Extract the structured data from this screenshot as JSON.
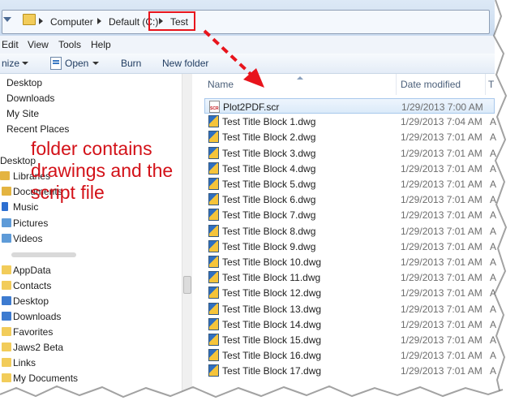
{
  "address": {
    "crumbs": [
      "Computer",
      "Default (C:)",
      "Test"
    ]
  },
  "menu": [
    "Edit",
    "View",
    "Tools",
    "Help"
  ],
  "toolbar": {
    "organize": "nize",
    "open": "Open",
    "burn": "Burn",
    "new_folder": "New folder"
  },
  "nav": {
    "items": [
      {
        "label": "Desktop",
        "icon": "desktop-icon",
        "color": "#3d7bd0"
      },
      {
        "label": "Downloads",
        "icon": "downloads-icon",
        "color": "#3d7bd0"
      },
      {
        "label": "My Site",
        "icon": "site-icon",
        "color": "#ffffff"
      },
      {
        "label": "Recent Places",
        "icon": "recent-places-icon",
        "color": "#ffffff"
      },
      {
        "label": "Desktop",
        "icon": "desktop-icon",
        "color": "#ffffff"
      },
      {
        "label": "Libraries",
        "icon": "libraries-icon",
        "color": "#e4b441"
      },
      {
        "label": "Documents",
        "icon": "documents-icon",
        "color": "#e4b441"
      },
      {
        "label": "Music",
        "icon": "music-icon",
        "color": "#2c6fd1"
      },
      {
        "label": "Pictures",
        "icon": "pictures-icon",
        "color": "#5e9bd8"
      },
      {
        "label": "Videos",
        "icon": "videos-icon",
        "color": "#5e9bd8"
      },
      {
        "label": "",
        "icon": "user-icon",
        "color": "#ffffff"
      },
      {
        "label": "AppData",
        "icon": "folder-icon",
        "color": "#f2cc5a"
      },
      {
        "label": "Contacts",
        "icon": "contacts-icon",
        "color": "#f2cc5a"
      },
      {
        "label": "Desktop",
        "icon": "folder-icon",
        "color": "#3d7bd0"
      },
      {
        "label": "Downloads",
        "icon": "folder-icon",
        "color": "#3d7bd0"
      },
      {
        "label": "Favorites",
        "icon": "favorites-icon",
        "color": "#f2cc5a"
      },
      {
        "label": "Jaws2 Beta",
        "icon": "folder-icon",
        "color": "#f2cc5a"
      },
      {
        "label": "Links",
        "icon": "folder-icon",
        "color": "#f2cc5a"
      },
      {
        "label": "My Documents",
        "icon": "folder-icon",
        "color": "#f2cc5a"
      }
    ]
  },
  "columns": {
    "name": "Name",
    "date": "Date modified",
    "type": "T"
  },
  "files": [
    {
      "name": "Plot2PDF.scr",
      "date": "1/29/2013 7:00 AM",
      "type": "",
      "icon": "scr-file-icon"
    },
    {
      "name": "Test Title Block 1.dwg",
      "date": "1/29/2013 7:04 AM",
      "type": "A",
      "icon": "dwg-file-icon"
    },
    {
      "name": "Test Title Block 2.dwg",
      "date": "1/29/2013 7:01 AM",
      "type": "A",
      "icon": "dwg-file-icon"
    },
    {
      "name": "Test Title Block 3.dwg",
      "date": "1/29/2013 7:01 AM",
      "type": "A",
      "icon": "dwg-file-icon"
    },
    {
      "name": "Test Title Block 4.dwg",
      "date": "1/29/2013 7:01 AM",
      "type": "A",
      "icon": "dwg-file-icon"
    },
    {
      "name": "Test Title Block 5.dwg",
      "date": "1/29/2013 7:01 AM",
      "type": "A",
      "icon": "dwg-file-icon"
    },
    {
      "name": "Test Title Block 6.dwg",
      "date": "1/29/2013 7:01 AM",
      "type": "A",
      "icon": "dwg-file-icon"
    },
    {
      "name": "Test Title Block 7.dwg",
      "date": "1/29/2013 7:01 AM",
      "type": "A",
      "icon": "dwg-file-icon"
    },
    {
      "name": "Test Title Block 8.dwg",
      "date": "1/29/2013 7:01 AM",
      "type": "A",
      "icon": "dwg-file-icon"
    },
    {
      "name": "Test Title Block 9.dwg",
      "date": "1/29/2013 7:01 AM",
      "type": "A",
      "icon": "dwg-file-icon"
    },
    {
      "name": "Test Title Block 10.dwg",
      "date": "1/29/2013 7:01 AM",
      "type": "A",
      "icon": "dwg-file-icon"
    },
    {
      "name": "Test Title Block 11.dwg",
      "date": "1/29/2013 7:01 AM",
      "type": "A",
      "icon": "dwg-file-icon"
    },
    {
      "name": "Test Title Block 12.dwg",
      "date": "1/29/2013 7:01 AM",
      "type": "A",
      "icon": "dwg-file-icon"
    },
    {
      "name": "Test Title Block 13.dwg",
      "date": "1/29/2013 7:01 AM",
      "type": "A",
      "icon": "dwg-file-icon"
    },
    {
      "name": "Test Title Block 14.dwg",
      "date": "1/29/2013 7:01 AM",
      "type": "A",
      "icon": "dwg-file-icon"
    },
    {
      "name": "Test Title Block 15.dwg",
      "date": "1/29/2013 7:01 AM",
      "type": "A",
      "icon": "dwg-file-icon"
    },
    {
      "name": "Test Title Block 16.dwg",
      "date": "1/29/2013 7:01 AM",
      "type": "A",
      "icon": "dwg-file-icon"
    },
    {
      "name": "Test Title Block 17.dwg",
      "date": "1/29/2013 7:01 AM",
      "type": "A",
      "icon": "dwg-file-icon"
    }
  ],
  "annotation": {
    "lines": [
      "folder contains",
      "drawings and the",
      "script file"
    ],
    "color": "#d31118"
  }
}
